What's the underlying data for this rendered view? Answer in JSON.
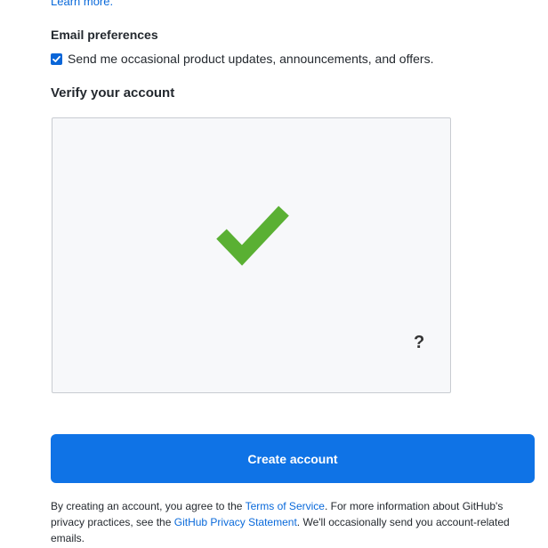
{
  "top_link": {
    "learn_more": "Learn more."
  },
  "email": {
    "label": "Email preferences",
    "checkbox_text": "Send me occasional product updates, announcements, and offers.",
    "checked": true
  },
  "verify": {
    "label": "Verify your account",
    "status_icon": "checkmark-icon",
    "check_color": "#5ab033",
    "help_text": "?"
  },
  "create_button": {
    "label": "Create account",
    "color": "#0f73e6"
  },
  "legal": {
    "text1": "By creating an account, you agree to the ",
    "terms_link": "Terms of Service",
    "text2": ". For more information about GitHub's privacy practices, see the ",
    "privacy_link": "GitHub Privacy Statement",
    "text3": ". We'll occasionally send you account-related emails."
  }
}
